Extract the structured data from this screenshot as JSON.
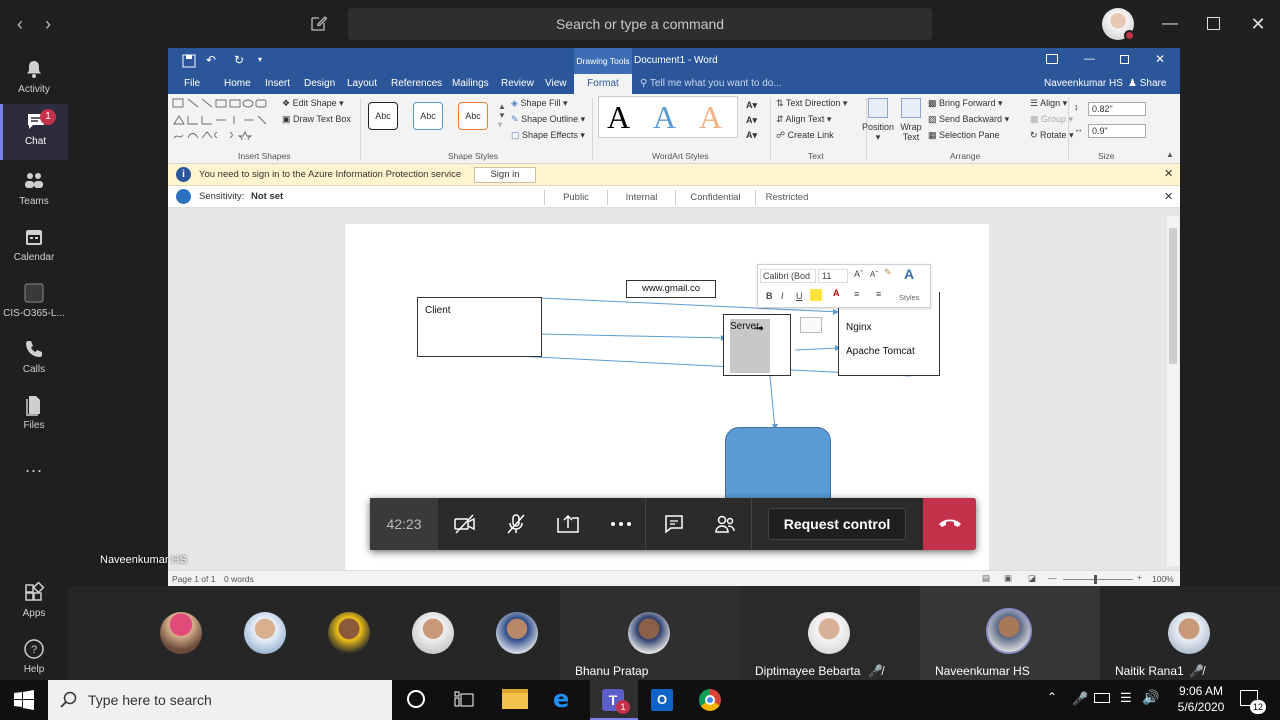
{
  "topbar": {
    "search_placeholder": "Search or type a command"
  },
  "rail": {
    "items": [
      {
        "label": "Activity"
      },
      {
        "label": "Chat",
        "badge": "1"
      },
      {
        "label": "Teams"
      },
      {
        "label": "Calendar"
      },
      {
        "label": "CIS-O365-L..."
      },
      {
        "label": "Calls"
      },
      {
        "label": "Files"
      },
      {
        "label": "..."
      }
    ],
    "bottom": [
      {
        "label": "Apps"
      },
      {
        "label": "Help"
      }
    ]
  },
  "word": {
    "title": "Document1 - Word",
    "context_tab": "Drawing Tools",
    "user": "Naveenkumar HS",
    "share": "Share",
    "tabs": [
      "File",
      "Home",
      "Insert",
      "Design",
      "Layout",
      "References",
      "Mailings",
      "Review",
      "View",
      "Format"
    ],
    "tell_me": "Tell me what you want to do...",
    "ribbon": {
      "edit_shape": "Edit Shape",
      "draw_text_box": "Draw Text Box",
      "insert_shapes": "Insert Shapes",
      "abc": "Abc",
      "shape_fill": "Shape Fill",
      "shape_outline": "Shape Outline",
      "shape_effects": "Shape Effects",
      "shape_styles": "Shape Styles",
      "wordart_letter": "A",
      "wordart_styles": "WordArt Styles",
      "text_direction": "Text Direction",
      "align_text": "Align Text",
      "create_link": "Create Link",
      "text_group": "Text",
      "position": "Position",
      "wrap_text": "Wrap Text",
      "bring_forward": "Bring Forward",
      "send_backward": "Send Backward",
      "selection_pane": "Selection Pane",
      "align": "Align",
      "group": "Group",
      "rotate": "Rotate",
      "arrange": "Arrange",
      "height": "0.82\"",
      "width": "0.9\"",
      "size": "Size"
    },
    "infobar": {
      "text": "You need to sign in to the Azure Information Protection service",
      "button": "Sign in"
    },
    "sensitivity": {
      "label": "Sensitivity:",
      "value": "Not set",
      "options": [
        "Public",
        "Internal",
        "Confidential",
        "Restricted"
      ]
    },
    "diagram": {
      "client": "Client",
      "email": "www.gmail.co",
      "server": "Server",
      "nginx": "Nginx",
      "tomcat": "Apache Tomcat"
    },
    "minitoolbar": {
      "font": "Calibri (Bod",
      "size": "11",
      "styles": "Styles",
      "bold": "B",
      "italic": "I",
      "underline": "U"
    },
    "status": {
      "page": "Page 1 of 1",
      "words": "0 words",
      "zoom": "100%"
    }
  },
  "call": {
    "timer": "42:23",
    "request_control": "Request control",
    "presenter": "Naveenkumar HS"
  },
  "participants": [
    {
      "name": ""
    },
    {
      "name": ""
    },
    {
      "name": ""
    },
    {
      "name": ""
    },
    {
      "name": ""
    },
    {
      "name": "Bhanu Pratap"
    },
    {
      "name": "Diptimayee Bebarta"
    },
    {
      "name": "Naveenkumar HS"
    },
    {
      "name": "Naitik Rana1"
    }
  ],
  "taskbar": {
    "search_placeholder": "Type here to search",
    "time": "9:06 AM",
    "date": "5/6/2020",
    "notif_count": "12",
    "teams_badge": "1"
  }
}
